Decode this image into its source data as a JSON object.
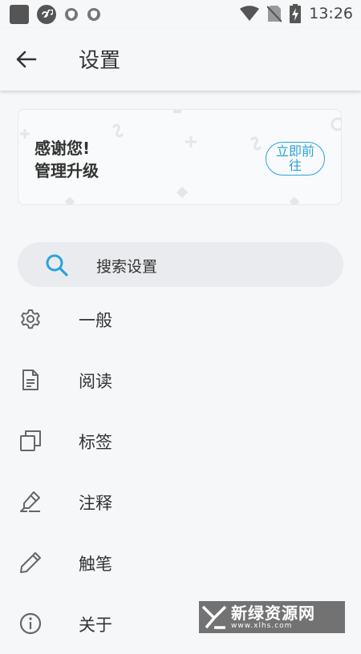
{
  "status_bar": {
    "time": "13:26"
  },
  "header": {
    "title": "设置"
  },
  "promo": {
    "line1": "感谢您!",
    "line2": "管理升级",
    "button_label": "立即前往"
  },
  "search": {
    "placeholder": "搜索设置"
  },
  "menu": {
    "items": [
      {
        "label": "一般",
        "icon": "gear-icon"
      },
      {
        "label": "阅读",
        "icon": "document-icon"
      },
      {
        "label": "标签",
        "icon": "copy-icon"
      },
      {
        "label": "注释",
        "icon": "highlighter-icon"
      },
      {
        "label": "触笔",
        "icon": "pencil-icon"
      },
      {
        "label": "关于",
        "icon": "info-icon"
      }
    ]
  },
  "watermark": {
    "text_cn": "新绿资源网",
    "text_en": "www.xlhs.com"
  },
  "colors": {
    "accent": "#2aa3d8",
    "icon": "#666666",
    "background": "#f6f7f9"
  }
}
